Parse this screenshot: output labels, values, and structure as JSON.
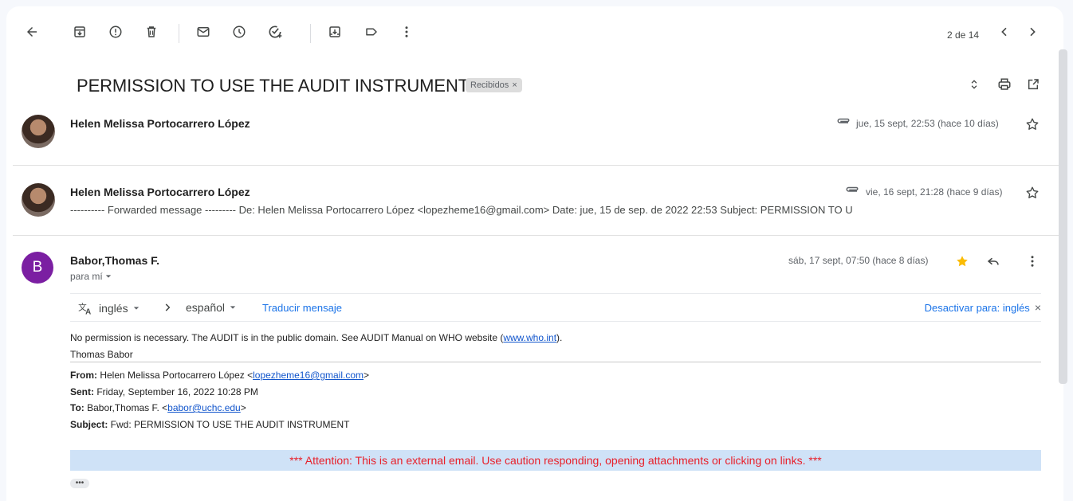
{
  "toolbar": {
    "icons": [
      "back-arrow-icon",
      "archive-icon",
      "report-spam-icon",
      "delete-icon",
      "mark-unread-icon",
      "snooze-icon",
      "add-task-icon",
      "move-to-icon",
      "label-icon",
      "more-vert-icon"
    ],
    "pager": "2 de 14"
  },
  "thread": {
    "subject": "PERMISSION TO USE THE AUDIT INSTRUMENT",
    "label": "Recibidos",
    "label_remove": "×"
  },
  "messages": [
    {
      "sender": "Helen Melissa Portocarrero López",
      "date": "jue, 15 sept, 22:53 (hace 10 días)",
      "has_attachment": true,
      "starred": false
    },
    {
      "sender": "Helen Melissa Portocarrero López",
      "date": "vie, 16 sept, 21:28 (hace 9 días)",
      "snippet": "---------- Forwarded message --------- De: Helen Melissa Portocarrero López <lopezheme16@gmail.com> Date: jue, 15 de sep. de 2022 22:53 Subject: PERMISSION TO U",
      "has_attachment": true,
      "starred": false
    },
    {
      "avatar_letter": "B",
      "avatar_color": "#7b1fa2",
      "sender": "Babor,Thomas F.",
      "date": "sáb, 17 sept, 07:50 (hace 8 días)",
      "to": "para mí",
      "starred": true
    }
  ],
  "translate": {
    "from_lang": "inglés",
    "to_lang": "español",
    "translate_link": "Traducir mensaje",
    "disable_link": "Desactivar para: inglés",
    "close": "×"
  },
  "body": {
    "line1_pre": "No permission is necessary.  The AUDIT is in the public domain.  See AUDIT Manual on WHO website (",
    "line1_link": "www.who.int",
    "line1_post": ").",
    "signature": "Thomas Babor",
    "from_label": "From:",
    "from_value_pre": " Helen Melissa Portocarrero López <",
    "from_email": "lopezheme16@gmail.com",
    "from_value_post": ">",
    "sent_label": "Sent:",
    "sent_value": " Friday, September 16, 2022 10:28 PM",
    "to_label": "To:",
    "to_value_pre": " Babor,Thomas F. <",
    "to_email": "babor@uchc.edu",
    "to_value_post": ">",
    "subject_label": "Subject:",
    "subject_value": " Fwd: PERMISSION TO USE THE AUDIT INSTRUMENT",
    "warning": "*** Attention: This is an external email. Use caution responding, opening attachments or clicking on links. ***",
    "more": "•••"
  },
  "colors": {
    "accent_link": "#1a73e8",
    "star_active": "#fbbc04",
    "warning_bg": "#cfe2f7",
    "warning_text": "#e8202a"
  }
}
